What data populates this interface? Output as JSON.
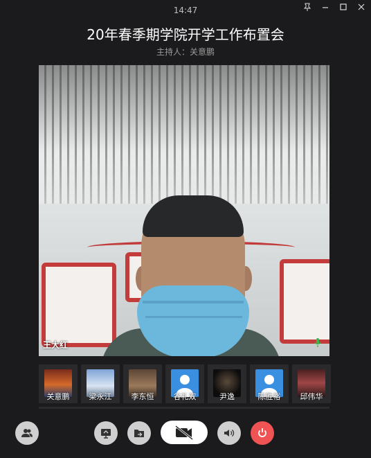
{
  "header": {
    "time": "14:47",
    "title": "20年春季期学院开学工作布置会",
    "host_label": "主持人：",
    "host_name": "关意鹏"
  },
  "window_controls": [
    "pin-icon",
    "minimize-icon",
    "maximize-icon",
    "close-icon"
  ],
  "main_video": {
    "speaker": "王大红",
    "mic": "active"
  },
  "participants": [
    {
      "name": "关意鹏",
      "avatar": "photo"
    },
    {
      "name": "梁永江",
      "avatar": "photo"
    },
    {
      "name": "李东恒",
      "avatar": "photo"
    },
    {
      "name": "谷礼双",
      "avatar": "default-user"
    },
    {
      "name": "尹逸",
      "avatar": "photo"
    },
    {
      "name": "陈胜裕",
      "avatar": "default-user"
    },
    {
      "name": "邱伟华",
      "avatar": "photo"
    }
  ],
  "controls": [
    "participants-icon",
    "share-screen-icon",
    "share-file-icon",
    "camera-off-icon",
    "speaker-icon",
    "hangup-icon"
  ],
  "colors": {
    "background": "#1b1b1d",
    "hangup": "#f05353",
    "user_avatar": "#3a8fe0"
  }
}
